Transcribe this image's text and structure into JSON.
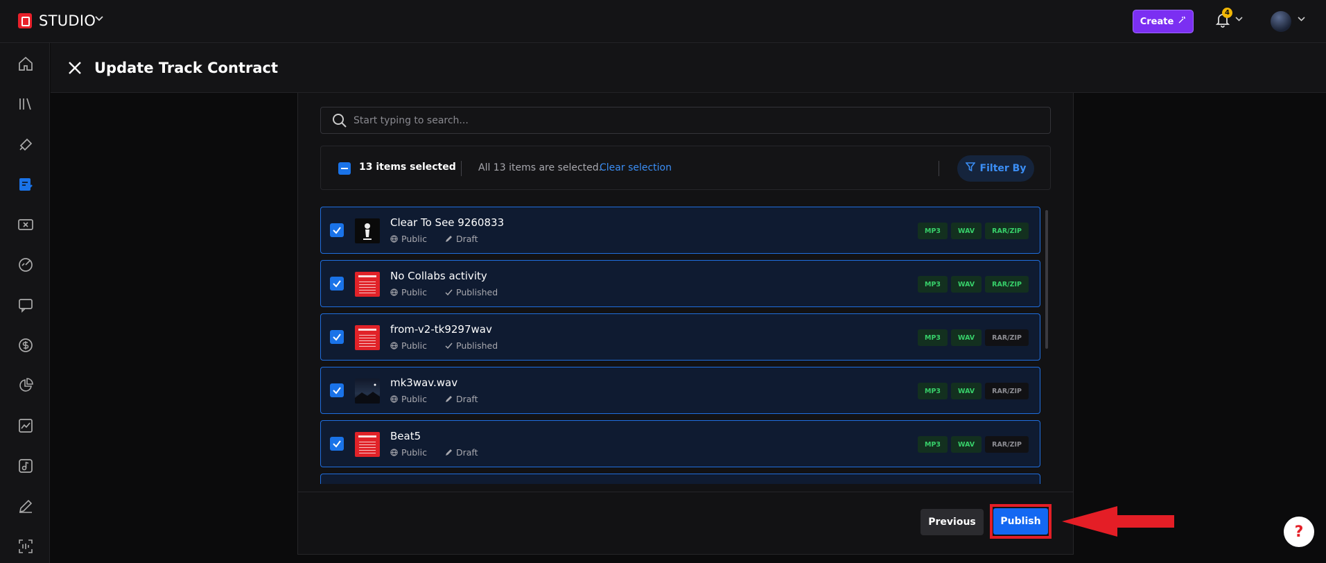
{
  "app": {
    "brand": "STUDIO",
    "create_label": "Create",
    "notification_count": "4"
  },
  "header": {
    "title": "Update Track Contract"
  },
  "search": {
    "placeholder": "Start typing to search..."
  },
  "selection": {
    "count_label": "13 items selected",
    "all_label": "All 13 items are selected.",
    "clear_label": "Clear selection",
    "filter_label": "Filter By"
  },
  "tracks": [
    {
      "title": "Clear To See 9260833",
      "visibility": "Public",
      "status": "Draft",
      "status_icon": "pencil-icon",
      "thumb": "dark",
      "formats": [
        {
          "label": "MP3",
          "on": true
        },
        {
          "label": "WAV",
          "on": true
        },
        {
          "label": "RAR/ZIP",
          "on": true
        }
      ]
    },
    {
      "title": "No Collabs activity",
      "visibility": "Public",
      "status": "Published",
      "status_icon": "check-icon",
      "thumb": "red",
      "formats": [
        {
          "label": "MP3",
          "on": true
        },
        {
          "label": "WAV",
          "on": true
        },
        {
          "label": "RAR/ZIP",
          "on": true
        }
      ]
    },
    {
      "title": "from-v2-tk9297wav",
      "visibility": "Public",
      "status": "Published",
      "status_icon": "check-icon",
      "thumb": "red",
      "formats": [
        {
          "label": "MP3",
          "on": true
        },
        {
          "label": "WAV",
          "on": true
        },
        {
          "label": "RAR/ZIP",
          "on": false
        }
      ]
    },
    {
      "title": "mk3wav.wav",
      "visibility": "Public",
      "status": "Draft",
      "status_icon": "pencil-icon",
      "thumb": "night",
      "formats": [
        {
          "label": "MP3",
          "on": true
        },
        {
          "label": "WAV",
          "on": true
        },
        {
          "label": "RAR/ZIP",
          "on": false
        }
      ]
    },
    {
      "title": "Beat5",
      "visibility": "Public",
      "status": "Draft",
      "status_icon": "pencil-icon",
      "thumb": "red",
      "formats": [
        {
          "label": "MP3",
          "on": true
        },
        {
          "label": "WAV",
          "on": true
        },
        {
          "label": "RAR/ZIP",
          "on": false
        }
      ]
    },
    {
      "title": "",
      "visibility": "",
      "status": "",
      "status_icon": "",
      "thumb": "red",
      "formats": []
    }
  ],
  "footer": {
    "previous_label": "Previous",
    "publish_label": "Publish",
    "help_label": "?"
  },
  "sidebar": {
    "items": [
      {
        "name": "home-icon"
      },
      {
        "name": "library-icon"
      },
      {
        "name": "promo-icon"
      },
      {
        "name": "contracts-icon"
      },
      {
        "name": "coupon-icon"
      },
      {
        "name": "analytics-icon"
      },
      {
        "name": "messages-icon"
      },
      {
        "name": "sales-icon"
      },
      {
        "name": "reports-icon"
      },
      {
        "name": "stats-icon"
      },
      {
        "name": "music-icon"
      },
      {
        "name": "edit-icon"
      },
      {
        "name": "scan-icon"
      }
    ],
    "active_index": 3
  },
  "colors": {
    "accent": "#1a73e8",
    "create": "#7b2ff2",
    "highlight": "#e41e26",
    "format_on": "#37d06a"
  }
}
